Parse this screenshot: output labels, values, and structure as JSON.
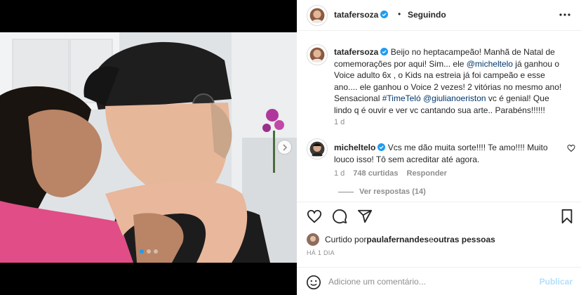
{
  "post": {
    "author": "tatafersoza",
    "follow_status": "Seguindo",
    "separator": "•",
    "carousel": {
      "slides": 3,
      "active": 0
    }
  },
  "caption": {
    "username": "tatafersoza",
    "text_1": " Beijo no heptacampeão! Manhã de Natal de comemorações por aqui! Sim... ele ",
    "mention_1": "@micheltelo",
    "text_2": " já ganhou o Voice adulto 6x , o Kids na estreia já foi campeão e esse ano.... ele ganhou o Voice 2 vezes! 2 vitórias no mesmo ano! Sensacional ",
    "hashtag": "#TimeTeló",
    "text_3": " ",
    "mention_2": "@giulianoeriston",
    "text_4": " vc é genial! Que lindo q é ouvir e ver vc cantando sua arte.. Parabéns!!!!!!",
    "time": "1 d"
  },
  "comment": {
    "username": "micheltelo",
    "text": " Vcs me dão muita sorte!!!! Te amo!!!! Muito louco isso! Tô sem acreditar até agora.",
    "time": "1 d",
    "likes": "748 curtidas",
    "reply_label": "Responder",
    "view_replies": "Ver respostas (14)"
  },
  "likes": {
    "prefix": "Curtido por ",
    "user": "paulafernandes",
    "middle": " e ",
    "others": "outras pessoas"
  },
  "time_ago": "HÁ 1 DIA",
  "composer": {
    "placeholder": "Adicione um comentário...",
    "post_label": "Publicar"
  },
  "icons": {
    "header_more": "more-horizontal-icon",
    "heart": "heart-icon",
    "comment": "comment-icon",
    "share": "share-icon",
    "save": "bookmark-icon",
    "emoji": "emoji-icon",
    "next": "chevron-right-icon",
    "verified": "verified-badge-icon"
  },
  "colors": {
    "verified": "#1f9bf0",
    "link": "#00376b",
    "muted": "#8e8e8e",
    "publish_disabled": "#b2dffc"
  }
}
